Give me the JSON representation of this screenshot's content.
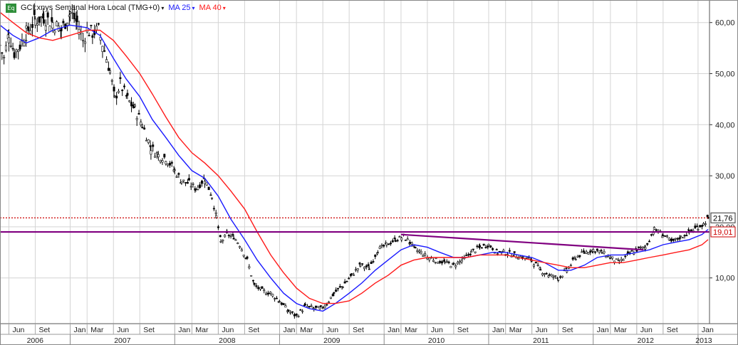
{
  "header": {
    "badge": "Eq",
    "symbol_label": "GCI:xnys Semanal Hora Local (TMG+0)",
    "ma_short_label": "MA 25",
    "ma_long_label": "MA 40",
    "caret": "▾"
  },
  "colors": {
    "price": "#000000",
    "ma_short": "#1a1aff",
    "ma_long": "#ff1a1a",
    "support_line": "#800080",
    "dotted_line": "#cc0000",
    "grid": "#d4d4d4",
    "badge_last_border": "#333333",
    "badge_level_border": "#cc0000"
  },
  "chart_data": {
    "type": "line",
    "title": "GCI:xnys Semanal Hora Local (TMG+0)",
    "x_kind": "date (weekly)",
    "x_range": [
      "2006-05-01",
      "2013-02-10"
    ],
    "ylim": [
      0,
      65
    ],
    "y_ticks": [
      "10,00",
      "20,00",
      "30,00",
      "40,00",
      "50,00",
      "60,00"
    ],
    "y_tick_values": [
      10,
      20,
      30,
      40,
      50,
      60
    ],
    "grid": true,
    "month_ticks": [
      {
        "label": "Jun",
        "date": "2006-06-01"
      },
      {
        "label": "Set",
        "date": "2006-09-01"
      },
      {
        "label": "Jan",
        "date": "2007-01-01"
      },
      {
        "label": "Mar",
        "date": "2007-03-01"
      },
      {
        "label": "Jun",
        "date": "2007-06-01"
      },
      {
        "label": "Set",
        "date": "2007-09-01"
      },
      {
        "label": "Jan",
        "date": "2008-01-01"
      },
      {
        "label": "Mar",
        "date": "2008-03-01"
      },
      {
        "label": "Jun",
        "date": "2008-06-01"
      },
      {
        "label": "Set",
        "date": "2008-09-01"
      },
      {
        "label": "Jan",
        "date": "2009-01-01"
      },
      {
        "label": "Mar",
        "date": "2009-03-01"
      },
      {
        "label": "Jun",
        "date": "2009-06-01"
      },
      {
        "label": "Set",
        "date": "2009-09-01"
      },
      {
        "label": "Jan",
        "date": "2010-01-01"
      },
      {
        "label": "Mar",
        "date": "2010-03-01"
      },
      {
        "label": "Jun",
        "date": "2010-06-01"
      },
      {
        "label": "Set",
        "date": "2010-09-01"
      },
      {
        "label": "Jan",
        "date": "2011-01-01"
      },
      {
        "label": "Mar",
        "date": "2011-03-01"
      },
      {
        "label": "Jun",
        "date": "2011-06-01"
      },
      {
        "label": "Set",
        "date": "2011-09-01"
      },
      {
        "label": "Jan",
        "date": "2012-01-01"
      },
      {
        "label": "Mar",
        "date": "2012-03-01"
      },
      {
        "label": "Jun",
        "date": "2012-06-01"
      },
      {
        "label": "Set",
        "date": "2012-09-01"
      },
      {
        "label": "Jan",
        "date": "2013-01-01"
      }
    ],
    "year_ticks": [
      {
        "label": "2006",
        "date": "2006-05-01"
      },
      {
        "label": "2007",
        "date": "2007-01-01"
      },
      {
        "label": "2008",
        "date": "2008-01-01"
      },
      {
        "label": "2009",
        "date": "2009-01-01"
      },
      {
        "label": "2010",
        "date": "2010-01-01"
      },
      {
        "label": "2011",
        "date": "2011-01-01"
      },
      {
        "label": "2012",
        "date": "2012-01-01"
      },
      {
        "label": "2013",
        "date": "2013-01-01"
      }
    ],
    "series": [
      {
        "name": "GCI:xnys",
        "style": "weekly-bars",
        "points": [
          [
            "2006-05-01",
            55.5
          ],
          [
            "2006-05-15",
            53.0
          ],
          [
            "2006-06-01",
            58.0
          ],
          [
            "2006-06-20",
            54.0
          ],
          [
            "2006-07-10",
            55.5
          ],
          [
            "2006-08-01",
            58.0
          ],
          [
            "2006-09-01",
            60.5
          ],
          [
            "2006-10-01",
            61.0
          ],
          [
            "2006-11-01",
            60.0
          ],
          [
            "2006-12-01",
            58.5
          ],
          [
            "2007-01-01",
            62.0
          ],
          [
            "2007-01-25",
            60.0
          ],
          [
            "2007-02-15",
            56.5
          ],
          [
            "2007-03-01",
            58.5
          ],
          [
            "2007-03-20",
            58.0
          ],
          [
            "2007-04-10",
            58.5
          ],
          [
            "2007-05-01",
            54.5
          ],
          [
            "2007-05-20",
            50.5
          ],
          [
            "2007-06-05",
            45.0
          ],
          [
            "2007-06-25",
            48.0
          ],
          [
            "2007-07-20",
            45.0
          ],
          [
            "2007-08-15",
            43.0
          ],
          [
            "2007-09-10",
            40.0
          ],
          [
            "2007-10-10",
            35.5
          ],
          [
            "2007-11-05",
            34.0
          ],
          [
            "2007-12-01",
            33.5
          ],
          [
            "2008-01-01",
            31.0
          ],
          [
            "2008-01-25",
            29.0
          ],
          [
            "2008-02-20",
            28.5
          ],
          [
            "2008-03-15",
            27.5
          ],
          [
            "2008-04-15",
            29.5
          ],
          [
            "2008-05-10",
            26.0
          ],
          [
            "2008-05-25",
            22.0
          ],
          [
            "2008-06-10",
            17.0
          ],
          [
            "2008-07-01",
            18.5
          ],
          [
            "2008-07-25",
            18.0
          ],
          [
            "2008-08-15",
            16.5
          ],
          [
            "2008-09-10",
            13.5
          ],
          [
            "2008-10-05",
            8.5
          ],
          [
            "2008-11-01",
            7.5
          ],
          [
            "2008-12-01",
            7.0
          ],
          [
            "2009-01-01",
            5.5
          ],
          [
            "2009-02-01",
            3.5
          ],
          [
            "2009-03-01",
            2.5
          ],
          [
            "2009-04-01",
            4.5
          ],
          [
            "2009-05-01",
            4.0
          ],
          [
            "2009-05-25",
            4.0
          ],
          [
            "2009-06-15",
            5.0
          ],
          [
            "2009-07-10",
            7.0
          ],
          [
            "2009-08-10",
            8.5
          ],
          [
            "2009-09-10",
            10.5
          ],
          [
            "2009-10-10",
            12.5
          ],
          [
            "2009-11-10",
            12.0
          ],
          [
            "2009-12-10",
            15.5
          ],
          [
            "2010-01-10",
            16.5
          ],
          [
            "2010-02-10",
            17.5
          ],
          [
            "2010-03-10",
            18.0
          ],
          [
            "2010-04-01",
            17.0
          ],
          [
            "2010-04-20",
            15.5
          ],
          [
            "2010-05-10",
            15.0
          ],
          [
            "2010-06-01",
            14.0
          ],
          [
            "2010-07-01",
            13.5
          ],
          [
            "2010-08-01",
            13.0
          ],
          [
            "2010-09-01",
            12.5
          ],
          [
            "2010-10-01",
            13.5
          ],
          [
            "2010-11-01",
            15.0
          ],
          [
            "2010-12-01",
            16.0
          ],
          [
            "2011-01-01",
            16.5
          ],
          [
            "2011-02-01",
            15.0
          ],
          [
            "2011-03-01",
            15.0
          ],
          [
            "2011-04-01",
            14.5
          ],
          [
            "2011-05-01",
            14.0
          ],
          [
            "2011-06-01",
            13.5
          ],
          [
            "2011-07-01",
            11.5
          ],
          [
            "2011-08-01",
            10.5
          ],
          [
            "2011-09-01",
            10.0
          ],
          [
            "2011-10-01",
            11.5
          ],
          [
            "2011-11-01",
            14.0
          ],
          [
            "2011-12-01",
            15.0
          ],
          [
            "2012-01-01",
            15.5
          ],
          [
            "2012-02-01",
            15.0
          ],
          [
            "2012-03-01",
            14.0
          ],
          [
            "2012-04-01",
            13.0
          ],
          [
            "2012-05-01",
            14.5
          ],
          [
            "2012-06-01",
            15.5
          ],
          [
            "2012-07-01",
            16.0
          ],
          [
            "2012-08-01",
            19.5
          ],
          [
            "2012-09-01",
            18.5
          ],
          [
            "2012-10-01",
            17.0
          ],
          [
            "2012-11-01",
            18.0
          ],
          [
            "2012-12-01",
            19.0
          ],
          [
            "2013-01-01",
            20.0
          ],
          [
            "2013-01-20",
            20.5
          ],
          [
            "2013-02-05",
            21.76
          ]
        ]
      },
      {
        "name": "MA 25",
        "style": "line",
        "points": [
          [
            "2006-05-01",
            59.5
          ],
          [
            "2006-06-15",
            57.5
          ],
          [
            "2006-08-01",
            56.0
          ],
          [
            "2006-09-15",
            57.0
          ],
          [
            "2006-11-01",
            58.5
          ],
          [
            "2007-01-01",
            59.5
          ],
          [
            "2007-03-01",
            59.0
          ],
          [
            "2007-04-15",
            57.5
          ],
          [
            "2007-06-01",
            53.0
          ],
          [
            "2007-07-15",
            49.0
          ],
          [
            "2007-09-01",
            45.5
          ],
          [
            "2007-10-15",
            41.0
          ],
          [
            "2007-12-01",
            37.5
          ],
          [
            "2008-01-15",
            34.0
          ],
          [
            "2008-03-01",
            31.0
          ],
          [
            "2008-04-15",
            29.5
          ],
          [
            "2008-06-01",
            26.0
          ],
          [
            "2008-07-15",
            21.5
          ],
          [
            "2008-09-01",
            17.5
          ],
          [
            "2008-10-15",
            13.5
          ],
          [
            "2008-12-01",
            10.0
          ],
          [
            "2009-01-15",
            7.0
          ],
          [
            "2009-03-01",
            5.0
          ],
          [
            "2009-04-15",
            4.0
          ],
          [
            "2009-06-01",
            3.5
          ],
          [
            "2009-07-15",
            5.0
          ],
          [
            "2009-09-01",
            7.0
          ],
          [
            "2009-10-15",
            9.0
          ],
          [
            "2009-12-01",
            11.5
          ],
          [
            "2010-01-15",
            13.5
          ],
          [
            "2010-03-01",
            15.5
          ],
          [
            "2010-04-15",
            16.5
          ],
          [
            "2010-06-01",
            16.0
          ],
          [
            "2010-07-15",
            15.0
          ],
          [
            "2010-09-01",
            14.0
          ],
          [
            "2010-10-15",
            14.0
          ],
          [
            "2010-12-01",
            14.5
          ],
          [
            "2011-01-15",
            15.0
          ],
          [
            "2011-03-01",
            15.0
          ],
          [
            "2011-04-15",
            14.5
          ],
          [
            "2011-06-01",
            14.0
          ],
          [
            "2011-07-15",
            13.0
          ],
          [
            "2011-09-01",
            11.5
          ],
          [
            "2011-10-15",
            11.5
          ],
          [
            "2011-12-01",
            12.5
          ],
          [
            "2012-01-15",
            14.0
          ],
          [
            "2012-03-01",
            14.5
          ],
          [
            "2012-04-15",
            14.5
          ],
          [
            "2012-06-01",
            15.0
          ],
          [
            "2012-07-15",
            15.5
          ],
          [
            "2012-09-01",
            16.5
          ],
          [
            "2012-10-15",
            17.0
          ],
          [
            "2012-12-01",
            17.5
          ],
          [
            "2013-01-15",
            18.5
          ],
          [
            "2013-02-05",
            19.5
          ]
        ]
      },
      {
        "name": "MA 40",
        "style": "line",
        "points": [
          [
            "2006-05-01",
            62.0
          ],
          [
            "2006-06-15",
            60.0
          ],
          [
            "2006-08-01",
            58.0
          ],
          [
            "2006-09-15",
            57.0
          ],
          [
            "2006-11-01",
            56.5
          ],
          [
            "2007-01-01",
            57.5
          ],
          [
            "2007-03-01",
            58.5
          ],
          [
            "2007-04-15",
            58.5
          ],
          [
            "2007-06-01",
            56.5
          ],
          [
            "2007-07-15",
            53.5
          ],
          [
            "2007-09-01",
            50.0
          ],
          [
            "2007-10-15",
            46.0
          ],
          [
            "2007-12-01",
            41.5
          ],
          [
            "2008-01-15",
            37.5
          ],
          [
            "2008-03-01",
            34.5
          ],
          [
            "2008-04-15",
            32.5
          ],
          [
            "2008-06-01",
            30.0
          ],
          [
            "2008-07-15",
            27.0
          ],
          [
            "2008-09-01",
            23.5
          ],
          [
            "2008-10-15",
            19.0
          ],
          [
            "2008-12-01",
            14.5
          ],
          [
            "2009-01-15",
            11.0
          ],
          [
            "2009-03-01",
            8.0
          ],
          [
            "2009-04-15",
            6.0
          ],
          [
            "2009-06-01",
            5.0
          ],
          [
            "2009-07-15",
            5.0
          ],
          [
            "2009-09-01",
            5.5
          ],
          [
            "2009-10-15",
            7.0
          ],
          [
            "2009-12-01",
            9.0
          ],
          [
            "2010-01-15",
            10.5
          ],
          [
            "2010-03-01",
            12.5
          ],
          [
            "2010-04-15",
            13.5
          ],
          [
            "2010-06-01",
            14.0
          ],
          [
            "2010-07-15",
            14.0
          ],
          [
            "2010-09-01",
            14.0
          ],
          [
            "2010-10-15",
            14.0
          ],
          [
            "2010-12-01",
            14.5
          ],
          [
            "2011-01-15",
            14.5
          ],
          [
            "2011-03-01",
            14.5
          ],
          [
            "2011-04-15",
            14.0
          ],
          [
            "2011-06-01",
            13.5
          ],
          [
            "2011-07-15",
            13.0
          ],
          [
            "2011-09-01",
            12.5
          ],
          [
            "2011-10-15",
            12.0
          ],
          [
            "2011-12-01",
            12.0
          ],
          [
            "2012-01-15",
            12.5
          ],
          [
            "2012-03-01",
            13.0
          ],
          [
            "2012-04-15",
            13.0
          ],
          [
            "2012-06-01",
            13.5
          ],
          [
            "2012-07-15",
            14.0
          ],
          [
            "2012-09-01",
            14.5
          ],
          [
            "2012-10-15",
            15.0
          ],
          [
            "2012-12-01",
            15.5
          ],
          [
            "2013-01-15",
            16.5
          ],
          [
            "2013-02-05",
            17.5
          ]
        ]
      }
    ],
    "annotations": [
      {
        "kind": "horizontal",
        "style": "solid",
        "color_key": "support_line",
        "y": 19.0
      },
      {
        "kind": "horizontal",
        "style": "dotted",
        "color_key": "dotted_line",
        "y": 21.76
      },
      {
        "kind": "trendline",
        "color_key": "support_line",
        "from": [
          "2010-03-01",
          18.5
        ],
        "to": [
          "2012-06-25",
          15.5
        ]
      }
    ],
    "value_badges": [
      {
        "label": "21,76",
        "y": 21.76,
        "style": "last"
      },
      {
        "label": "19,01",
        "y": 19.01,
        "style": "level"
      }
    ]
  }
}
